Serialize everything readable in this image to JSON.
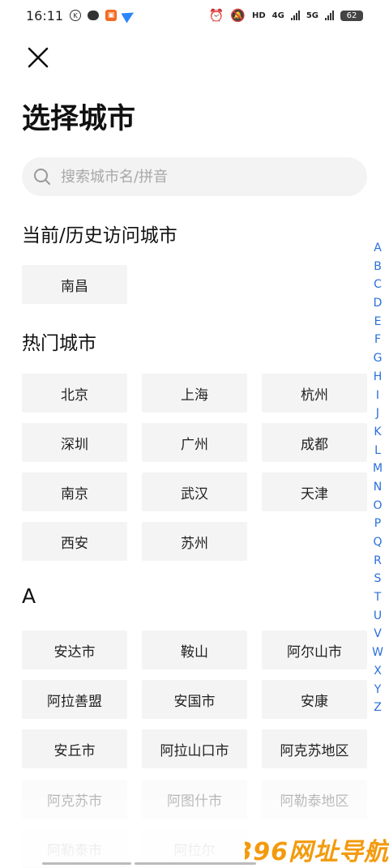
{
  "status_bar": {
    "time": "16:11",
    "battery": "62",
    "network_1": "4G",
    "network_2": "5G",
    "hd_badge": "HD"
  },
  "header": {
    "title": "选择城市"
  },
  "search": {
    "placeholder": "搜索城市名/拼音"
  },
  "sections": {
    "recent_title": "当前/历史访问城市",
    "hot_title": "热门城市",
    "a_title": "A"
  },
  "recent_cities": [
    "南昌"
  ],
  "hot_cities": [
    "北京",
    "上海",
    "杭州",
    "深圳",
    "广州",
    "成都",
    "南京",
    "武汉",
    "天津",
    "西安",
    "苏州"
  ],
  "a_cities": [
    "安达市",
    "鞍山",
    "阿尔山市",
    "阿拉善盟",
    "安国市",
    "安康",
    "安丘市",
    "阿拉山口市",
    "阿克苏地区",
    "阿克苏市",
    "阿图什市",
    "阿勒泰地区",
    "阿勒泰市",
    "阿拉尔"
  ],
  "index_letters": [
    "A",
    "B",
    "C",
    "D",
    "E",
    "F",
    "G",
    "H",
    "I",
    "J",
    "K",
    "L",
    "M",
    "N",
    "O",
    "P",
    "Q",
    "R",
    "S",
    "T",
    "U",
    "V",
    "W",
    "X",
    "Y",
    "Z"
  ],
  "watermark": "396网址导航",
  "colors": {
    "accent": "#2a6fdb",
    "button_bg": "#f4f4f4",
    "search_bg": "#f3f3f3"
  }
}
